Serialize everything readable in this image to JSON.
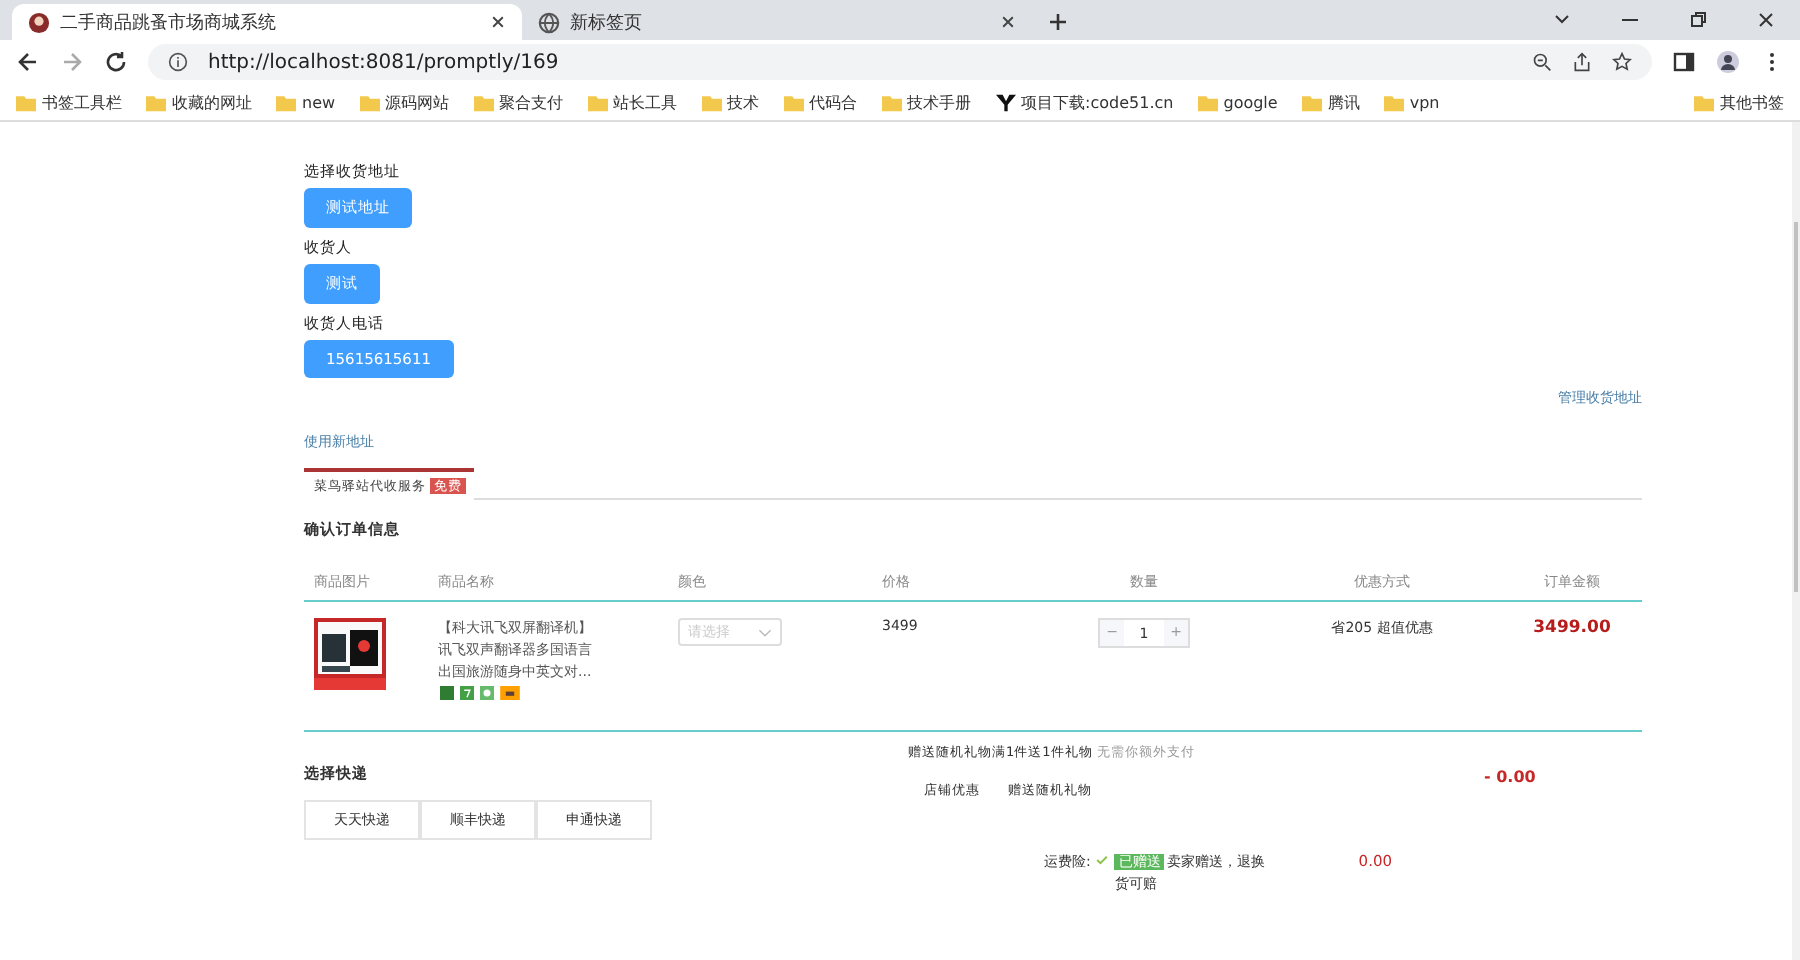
{
  "browser": {
    "tabs": [
      {
        "title": "二手商品跳蚤市场商城系统",
        "selected": true
      },
      {
        "title": "新标签页",
        "selected": false
      }
    ],
    "url": "http://localhost:8081/promptly/169",
    "bookmarks": [
      {
        "label": "书签工具栏",
        "kind": "folder"
      },
      {
        "label": "收藏的网址",
        "kind": "folder"
      },
      {
        "label": "new",
        "kind": "folder"
      },
      {
        "label": "源码网站",
        "kind": "folder"
      },
      {
        "label": "聚合支付",
        "kind": "folder"
      },
      {
        "label": "站长工具",
        "kind": "folder"
      },
      {
        "label": "技术",
        "kind": "folder"
      },
      {
        "label": "代码合",
        "kind": "folder"
      },
      {
        "label": "技术手册",
        "kind": "folder"
      },
      {
        "label": "项目下载:code51.cn",
        "kind": "site"
      },
      {
        "label": "google",
        "kind": "folder"
      },
      {
        "label": "腾讯",
        "kind": "folder"
      },
      {
        "label": "vpn",
        "kind": "folder"
      }
    ],
    "other_bookmarks": "其他书签"
  },
  "address": {
    "sections": [
      {
        "label": "选择收货地址",
        "value": "测试地址"
      },
      {
        "label": "收货人",
        "value": "测试"
      },
      {
        "label": "收货人电话",
        "value": "15615615611"
      }
    ],
    "manage_link": "管理收货地址",
    "new_link": "使用新地址"
  },
  "service_tab": {
    "label": "菜鸟驿站代收服务",
    "badge": "免费"
  },
  "order": {
    "title": "确认订单信息",
    "columns": [
      "商品图片",
      "商品名称",
      "颜色",
      "价格",
      "数量",
      "优惠方式",
      "订单金额"
    ],
    "rows": [
      {
        "name": "【科大讯飞双屏翻译机】讯飞双声翻译器多国语言出国旅游随身中英文对...",
        "color_placeholder": "请选择",
        "price": "3499",
        "quantity": "1",
        "decrement": "−",
        "increment": "+",
        "discount": "省205 超值优惠",
        "amount": "3499.00"
      }
    ]
  },
  "gift": {
    "text": "赠送随机礼物满1件送1件礼物",
    "note": "无需你额外支付",
    "shop_label": "店铺优惠",
    "shop_value": "赠送随机礼物",
    "amount": "- 0.00"
  },
  "shipping": {
    "title": "选择快递",
    "options": [
      {
        "label": "天天快递",
        "selected": false
      },
      {
        "label": "顺丰快递",
        "selected": false
      },
      {
        "label": "申通快递",
        "selected": false
      }
    ]
  },
  "insurance": {
    "label": "运费险:",
    "checked": true,
    "badge": "已赠送",
    "text": "卖家赠送，退换货可赔",
    "amount": "0.00"
  }
}
